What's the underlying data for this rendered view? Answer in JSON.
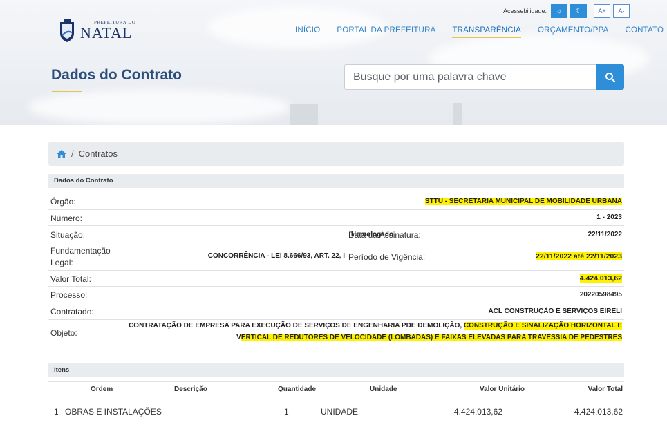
{
  "header": {
    "logo_small": "PREFEITURA DO",
    "logo_big": "NATAL",
    "accessibility_label": "Acessebilidade:",
    "contrast_buttons": [
      "☼",
      "☾"
    ],
    "font_buttons": [
      "A+",
      "A-"
    ],
    "nav": [
      "INÍCIO",
      "PORTAL DA PREFEITURA",
      "TRANSPARÊNCIA",
      "ORÇAMENTO/PPA",
      "CONTATO"
    ],
    "page_title": "Dados do Contrato",
    "search_placeholder": "Busque por uma palavra chave"
  },
  "breadcrumb": {
    "current": "Contratos",
    "separator": "/"
  },
  "contract": {
    "section_title": "Dados do Contrato",
    "orgao_label": "Órgão:",
    "orgao": "STTU - SECRETARIA MUNICIPAL DE MOBILIDADE URBANA",
    "numero_label": "Número:",
    "numero": "1 - 2023",
    "situacao_label": "Situação:",
    "situacao": "Homologado",
    "data_assinatura_label": "Data da Assinatura:",
    "data_assinatura": "22/11/2022",
    "fundamentacao_label_1": "Fundamentação",
    "fundamentacao_label_2": "Legal:",
    "fundamentacao": "CONCORRÊNCIA - LEI 8.666/93, ART. 22, I",
    "vigencia_label": "Período de Vigência:",
    "vigencia": "22/11/2022 até 22/11/2023",
    "valor_label": "Valor Total:",
    "valor": "4.424.013,62",
    "processo_label": "Processo:",
    "processo": "20220598495",
    "contratado_label": "Contratado:",
    "contratado": "ACL CONSTRUÇÃO E SERVIÇOS EIRELI",
    "objeto_label": "Objeto:",
    "objeto_line1_plain": "CONTRATAÇÃO DE EMPRESA PARA EXECUÇÃO DE SERVIÇOS DE ENGENHARIA PDE DEMOLIÇÃO, ",
    "objeto_line1_hl": "CONSTRUÇÃO E SINALIZAÇÃO HORIZONTAL E",
    "objeto_line2_plain": "V",
    "objeto_line2_hl": "ERTICAL DE REDUTORES DE VELOCIDADE (LOMBADAS) E FAIXAS ELEVADAS PARA TRAVESSIA DE PEDESTRES"
  },
  "items": {
    "section_title": "Itens",
    "columns": [
      "Ordem",
      "Descrição",
      "Quantidade",
      "Unidade",
      "Valor Unitário",
      "Valor Total"
    ],
    "rows": [
      {
        "ordem": "1",
        "descricao": "OBRAS E INSTALAÇÕES",
        "quantidade": "1",
        "unidade": "UNIDADE",
        "valor_unitario": "4.424.013,62",
        "valor_total": "4.424.013,62"
      }
    ]
  },
  "colors": {
    "accent": "#2f8ed8",
    "title": "#2b4f7a",
    "underline": "#e8c34a",
    "highlight": "#fff200"
  }
}
